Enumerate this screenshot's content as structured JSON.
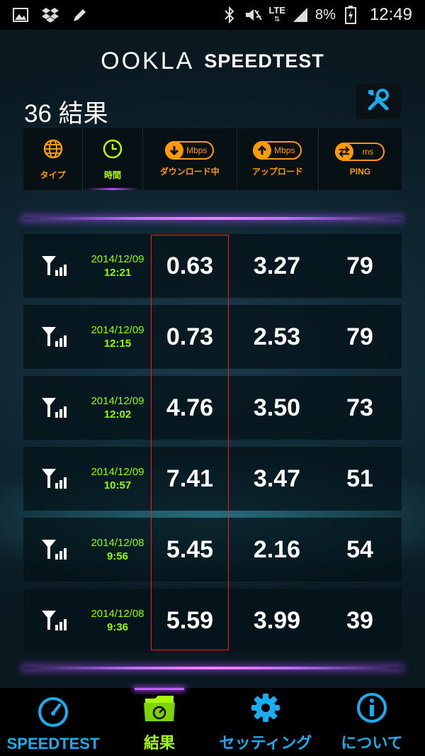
{
  "status_bar": {
    "battery_percent": "8%",
    "time": "12:49",
    "network": "LTE"
  },
  "header": {
    "logo_brand": "OOKLA",
    "logo_product": "SPEEDTEST",
    "results_title": "36 結果"
  },
  "sort_bar": {
    "items": [
      {
        "label": "タイプ",
        "icon": "globe-icon"
      },
      {
        "label": "時間",
        "icon": "clock-icon",
        "active": true
      },
      {
        "label": "ダウンロード中",
        "icon": "download-icon",
        "unit": "Mbps"
      },
      {
        "label": "アップロード",
        "icon": "upload-icon",
        "unit": "Mbps"
      },
      {
        "label": "PING",
        "icon": "ping-icon",
        "unit": "ms"
      }
    ]
  },
  "results": [
    {
      "date": "2014/12/09",
      "time": "12:21",
      "download": "0.63",
      "upload": "3.27",
      "ping": "79"
    },
    {
      "date": "2014/12/09",
      "time": "12:15",
      "download": "0.73",
      "upload": "2.53",
      "ping": "79"
    },
    {
      "date": "2014/12/09",
      "time": "12:02",
      "download": "4.76",
      "upload": "3.50",
      "ping": "73"
    },
    {
      "date": "2014/12/09",
      "time": "10:57",
      "download": "7.41",
      "upload": "3.47",
      "ping": "51"
    },
    {
      "date": "2014/12/08",
      "time": "9:56",
      "download": "5.45",
      "upload": "2.16",
      "ping": "54"
    },
    {
      "date": "2014/12/08",
      "time": "9:36",
      "download": "5.59",
      "upload": "3.99",
      "ping": "39"
    }
  ],
  "bottom_nav": [
    {
      "label": "SPEEDTEST",
      "icon": "speedometer-icon"
    },
    {
      "label": "結果",
      "icon": "results-folder-icon",
      "active": true
    },
    {
      "label": "セッティング",
      "icon": "gear-icon"
    },
    {
      "label": "について",
      "icon": "info-icon"
    }
  ],
  "colors": {
    "accent_orange": "#ff9a00",
    "accent_green": "#8cff00",
    "accent_blue": "#19aef0",
    "highlight_red": "#ff1a1a",
    "glow_purple": "#c070ff"
  }
}
